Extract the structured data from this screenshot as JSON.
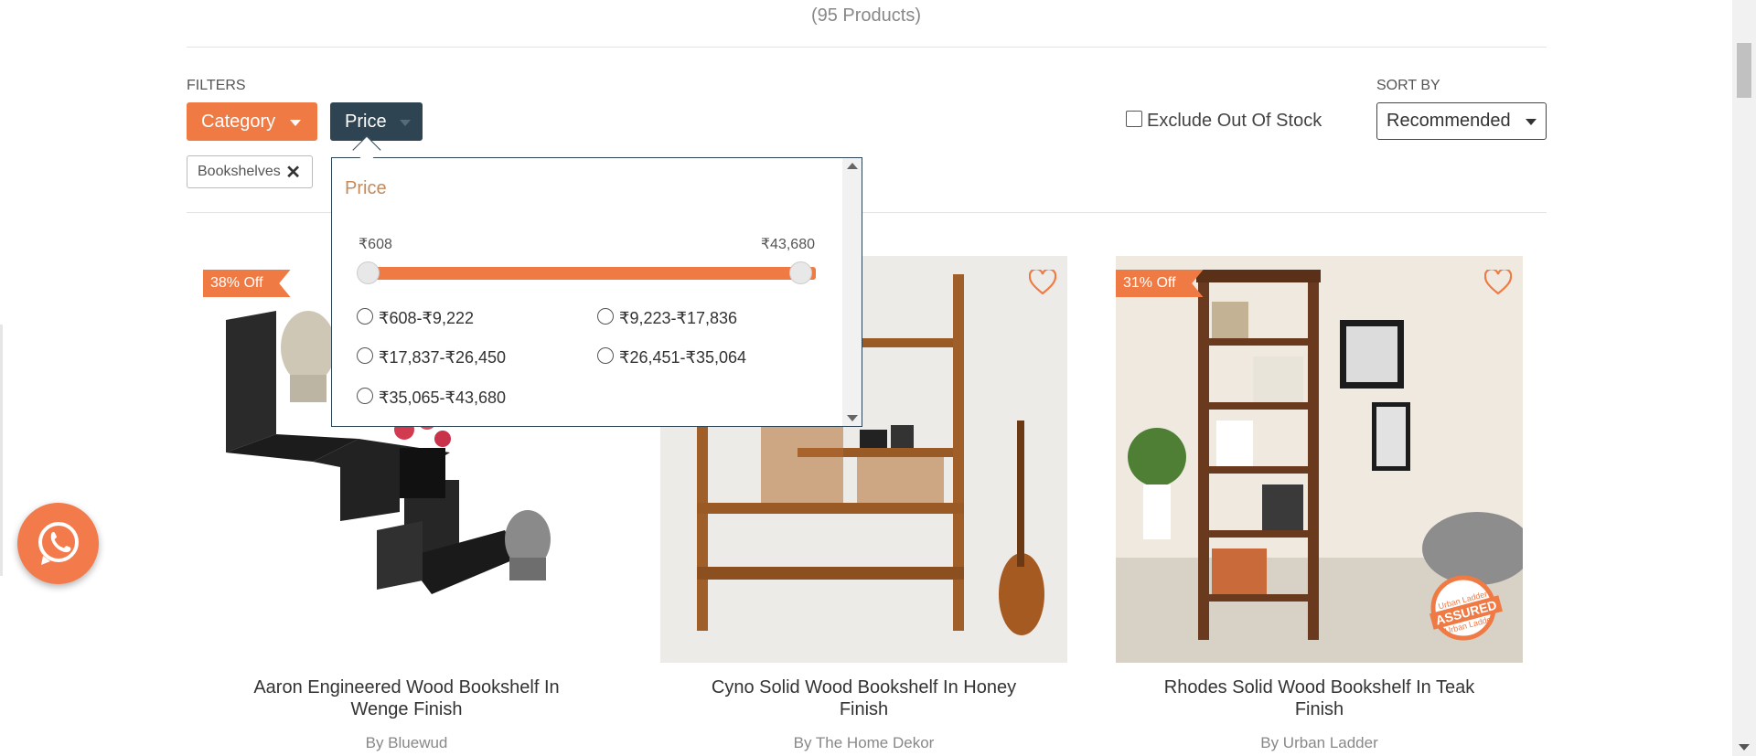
{
  "header": {
    "product_count": "(95 Products)"
  },
  "filters": {
    "label": "FILTERS",
    "category_label": "Category",
    "price_label": "Price",
    "exclude_out_of_stock": "Exclude Out Of Stock",
    "applied_chip": "Bookshelves"
  },
  "sort": {
    "label": "SORT BY",
    "selected": "Recommended"
  },
  "price_dropdown": {
    "title": "Price",
    "min": "₹608",
    "max": "₹43,680",
    "ranges": [
      "₹608-₹9,222",
      "₹9,223-₹17,836",
      "₹17,837-₹26,450",
      "₹26,451-₹35,064",
      "₹35,065-₹43,680"
    ]
  },
  "products": [
    {
      "name": "Aaron Engineered Wood Bookshelf In Wenge Finish",
      "brand": "By Bluewud",
      "discount": "38% Off"
    },
    {
      "name": "Cyno Solid Wood Bookshelf In Honey Finish",
      "brand": "By The Home Dekor",
      "discount": ""
    },
    {
      "name": "Rhodes Solid Wood Bookshelf In Teak Finish",
      "brand": "By Urban Ladder",
      "discount": "31% Off",
      "stamp": "ASSURED",
      "stamp_top": "Urban Ladder",
      "stamp_bottom": "Urban Ladder"
    }
  ],
  "colors": {
    "accent": "#f07a44",
    "dark": "#2e4452"
  }
}
